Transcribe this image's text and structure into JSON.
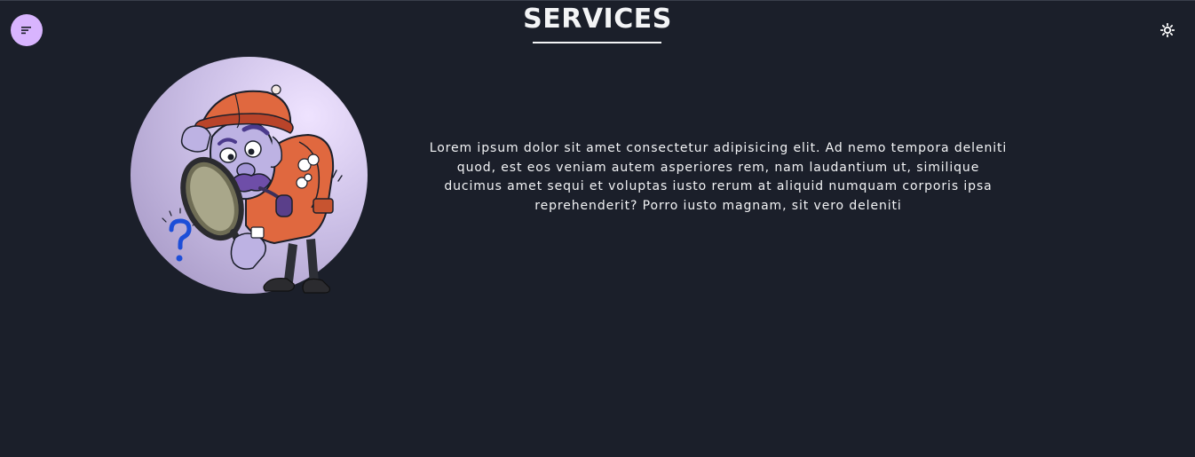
{
  "header": {
    "title": "SERVICES"
  },
  "toolbar": {
    "menu_icon": "sort-lines-icon",
    "theme_icon": "sun-icon"
  },
  "main": {
    "image_alt": "detective-with-magnifying-glass",
    "description": "Lorem ipsum dolor sit amet consectetur adipisicing elit. Ad nemo tempora deleniti quod, est eos veniam autem asperiores rem, nam laudantium ut, similique ducimus amet sequi et voluptas iusto rerum at aliquid numquam corporis ipsa reprehenderit? Porro iusto magnam, sit vero deleniti"
  },
  "colors": {
    "background": "#1b1f2a",
    "accent": "#d8b4fe",
    "text": "#f3f4f6"
  }
}
